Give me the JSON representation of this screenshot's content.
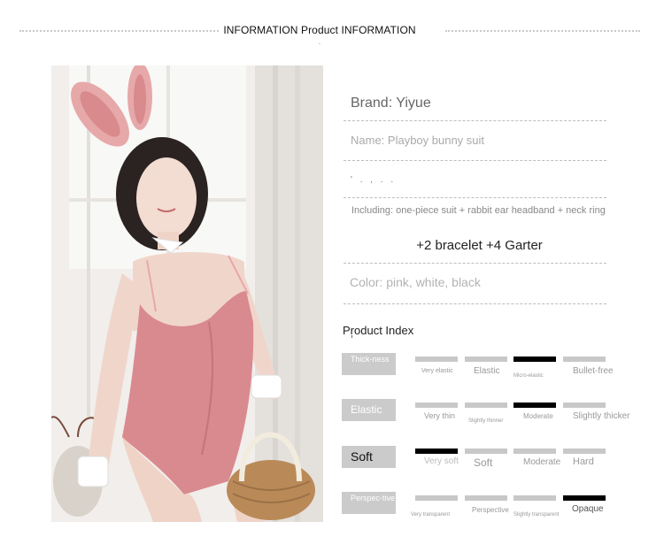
{
  "header": {
    "title_left": "INFORMATION",
    "title_mid": "Product",
    "title_right": "INFORMATION",
    "dot": "·"
  },
  "info": {
    "brand": "Brand: Yiyue",
    "name": "Name: Playboy bunny suit",
    "garbled": "' . ,  . .",
    "including": "Including: one-piece suit + rabbit ear headband + neck ring",
    "bracelet": "+2 bracelet +4 Garter",
    "color": "Color: pink, white, black"
  },
  "index": {
    "title": "Product Index",
    "rows": [
      {
        "label": "Thick-ness",
        "options": [
          "Very elastic",
          "Elastic",
          "Micro-elastic",
          "Bullet-free"
        ],
        "selected": 2
      },
      {
        "label": "Elastic",
        "options": [
          "Very thin",
          "Slightly thinner",
          "Moderate",
          "Slightly thicker"
        ],
        "selected": 2
      },
      {
        "label": "Soft",
        "options": [
          "Very soft",
          "Soft",
          "Moderate",
          "Hard"
        ],
        "selected": 0
      },
      {
        "label": "Perspec-tive",
        "options": [
          "Very transparent",
          "Perspective",
          "Slightly transparent",
          "Opaque"
        ],
        "selected": 3
      }
    ]
  },
  "colors": {
    "bar_selected": "#000000",
    "bar_default": "#c8c8c8",
    "label_bg": "#cbcbcb",
    "suit_pink": "#d98a8f"
  }
}
